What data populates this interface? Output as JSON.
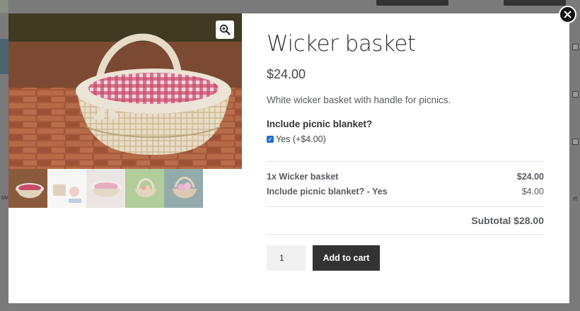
{
  "background": {
    "right_text_1": "rt",
    "left_text_1": "ov"
  },
  "modal": {
    "close_icon": "close-icon",
    "zoom_icon": "zoom-in-icon",
    "thumbnails": [
      {
        "alt": "wicker basket with gingham lining",
        "active": true
      },
      {
        "alt": "picnic scene on white blanket",
        "active": false
      },
      {
        "alt": "basket with pink lining",
        "active": false
      },
      {
        "alt": "basket on grass with flowers",
        "active": false
      },
      {
        "alt": "basket with pink flowers",
        "active": false
      }
    ]
  },
  "product": {
    "title": "Wicker basket",
    "price": "$24.00",
    "description": "White wicker basket with handle for picnics.",
    "addon_heading": "Include picnic blanket?",
    "addon_option": "Yes (+$4.00)",
    "addon_checked": true,
    "summary_lines": [
      {
        "name": "1x Wicker basket",
        "amount": "$24.00"
      },
      {
        "name": "Include picnic blanket? - Yes",
        "amount": "$4.00"
      }
    ],
    "subtotal": "Subtotal $28.00",
    "quantity": "1",
    "add_to_cart_label": "Add to cart"
  },
  "colors": {
    "overlay": "#7a7a7a",
    "button_dark": "#333333",
    "checkbox_blue": "#1f6fd0"
  }
}
